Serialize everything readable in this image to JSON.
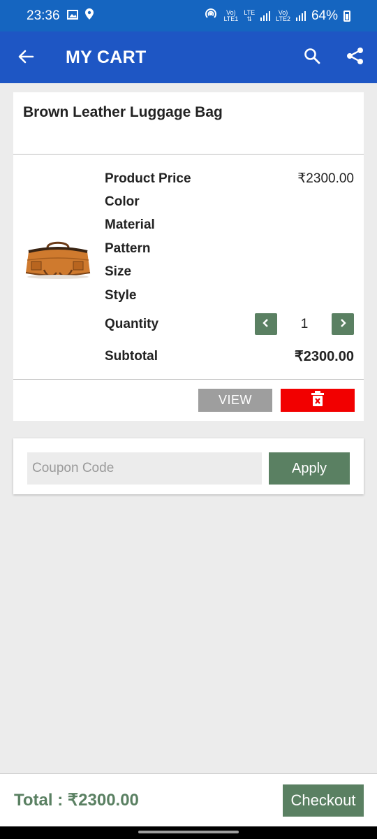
{
  "status_bar": {
    "time": "23:36",
    "sim1_label_top": "Vo)",
    "sim1_label_bottom": "LTE1",
    "lte_label": "LTE",
    "sim2_label_top": "Vo)",
    "sim2_label_bottom": "LTE2",
    "battery": "64%"
  },
  "app_bar": {
    "title": "MY CART",
    "back_icon": "arrow-left-icon",
    "search_icon": "search-icon",
    "share_icon": "share-icon"
  },
  "cart_item": {
    "name": "Brown Leather Luggage Bag",
    "image_icon": "luggage-bag-image",
    "price_label": "Product Price",
    "price_value": "₹2300.00",
    "color_label": "Color",
    "material_label": "Material",
    "pattern_label": "Pattern",
    "size_label": "Size",
    "style_label": "Style",
    "quantity_label": "Quantity",
    "quantity_value": "1",
    "subtotal_label": "Subtotal",
    "subtotal_value": "₹2300.00",
    "view_label": "VIEW",
    "delete_icon": "trash-icon"
  },
  "coupon": {
    "placeholder": "Coupon Code",
    "apply_label": "Apply"
  },
  "footer": {
    "total": "Total : ₹2300.00",
    "checkout_label": "Checkout"
  },
  "colors": {
    "app_bar": "#1e56c4",
    "status_bar": "#1565c0",
    "accent_green": "#5a8062",
    "delete_red": "#f20000",
    "view_grey": "#9e9e9e"
  }
}
